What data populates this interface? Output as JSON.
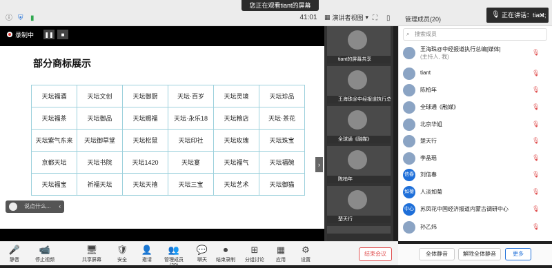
{
  "banner": "您正在观看tiant的屏幕",
  "timer": "41:01",
  "view_mode": "演讲者视图",
  "participants_title": "管理成员(20)",
  "speaking_toast": "正在讲话：tiant;",
  "recording": {
    "label": "录制中"
  },
  "slide": {
    "title": "部分商标展示",
    "table": [
      [
        "天坛福酒",
        "天坛文创",
        "天坛御厨",
        "天坛·百岁",
        "天坛灵境",
        "天坛珍品"
      ],
      [
        "天坛福茶",
        "天坛御品",
        "天坛赐福",
        "天坛·永乐18",
        "天坛粮店",
        "天坛·茶花"
      ],
      [
        "天坛紫气东来",
        "天坛御草堂",
        "天坛松鼠",
        "天坛印社",
        "天坛玫瑰",
        "天坛珠宝"
      ],
      [
        "京都天坛",
        "天坛书院",
        "天坛1420",
        "天坛宴",
        "天坛福气",
        "天坛福碗"
      ],
      [
        "天坛福宝",
        "祈福天坛",
        "天坛天禧",
        "天坛三宝",
        "天坛艺术",
        "天坛御猫"
      ]
    ]
  },
  "comment_placeholder": "说点什么...",
  "video_tiles": [
    {
      "caption": "tiant的屏幕共享"
    },
    {
      "caption": "王海珠@中经报道执行总编"
    },
    {
      "caption": "全球通《融媒》"
    },
    {
      "caption": "陈柏年"
    },
    {
      "caption": "楚天行"
    },
    {
      "caption": ""
    }
  ],
  "search_placeholder": "搜索成员",
  "participants": [
    {
      "name": "王海珠@中经报道执行总编[媒体]",
      "sub": "(主持人, 我)",
      "avatar": ""
    },
    {
      "name": "tiant",
      "sub": "",
      "avatar": ""
    },
    {
      "name": "陈柏年",
      "sub": "",
      "avatar": ""
    },
    {
      "name": "全球通《融媒》",
      "sub": "",
      "avatar": ""
    },
    {
      "name": "北京华姐",
      "sub": "",
      "avatar": ""
    },
    {
      "name": "楚天行",
      "sub": "",
      "avatar": ""
    },
    {
      "name": "李晶瑶",
      "sub": "",
      "avatar": ""
    },
    {
      "name": "刘信春",
      "sub": "",
      "avatar": "信春"
    },
    {
      "name": "人淡如菊",
      "sub": "",
      "avatar": "如菊"
    },
    {
      "name": "苏凤花中国经济报道内蒙古调研中心",
      "sub": "",
      "avatar": "中心"
    },
    {
      "name": "孙乙炜",
      "sub": "",
      "avatar": ""
    }
  ],
  "panel_footer": {
    "mute_all": "全体静音",
    "unmute_all": "解除全体静音",
    "more": "更多"
  },
  "toolbar": [
    {
      "label": "静音",
      "icon": "🎤"
    },
    {
      "label": "停止视频",
      "icon": "📹"
    },
    {
      "label": "共享屏幕",
      "icon": "🖥"
    },
    {
      "label": "安全",
      "icon": "🛡"
    },
    {
      "label": "邀请",
      "icon": "👤"
    },
    {
      "label": "管理成员(20)",
      "icon": "👥"
    },
    {
      "label": "聊天",
      "icon": "💬"
    },
    {
      "label": "结束录制",
      "icon": "⏺"
    },
    {
      "label": "分组讨论",
      "icon": "⊞"
    },
    {
      "label": "应用",
      "icon": "▦"
    },
    {
      "label": "设置",
      "icon": "⚙"
    }
  ],
  "end_meeting": "结束会议"
}
